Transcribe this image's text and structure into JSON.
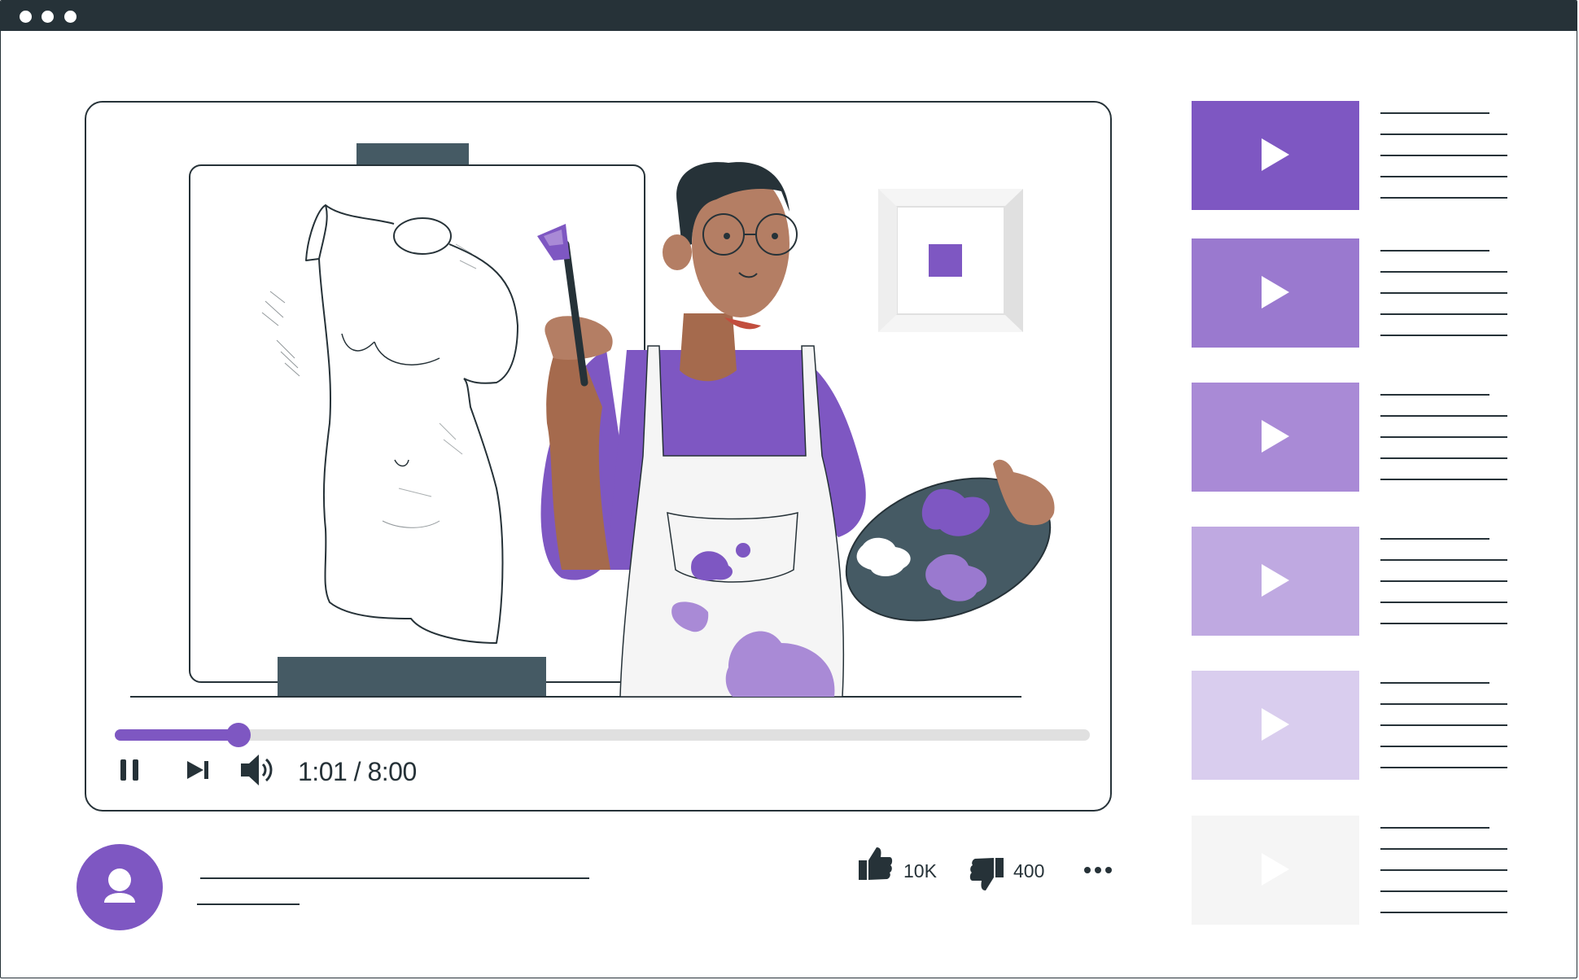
{
  "player": {
    "time_display": "1:01 / 8:00",
    "progress_fraction": 0.127
  },
  "reactions": {
    "likes": "10K",
    "dislikes": "400"
  },
  "icons": {
    "pause": "pause-icon",
    "next": "skip-next-icon",
    "volume": "volume-icon",
    "like": "thumbs-up-icon",
    "dislike": "thumbs-down-icon",
    "more": "more-horizontal-icon",
    "avatar": "user-icon",
    "play": "play-icon"
  },
  "playlist": [
    {
      "color": "#7e57c2"
    },
    {
      "color": "#9a79cf"
    },
    {
      "color": "#a98ad6"
    },
    {
      "color": "#bfa9e1"
    },
    {
      "color": "#d9cdee"
    },
    {
      "color": "#f5f5f5"
    }
  ],
  "colors": {
    "accent": "#7e57c2",
    "dark": "#263238",
    "slate": "#455a64"
  }
}
